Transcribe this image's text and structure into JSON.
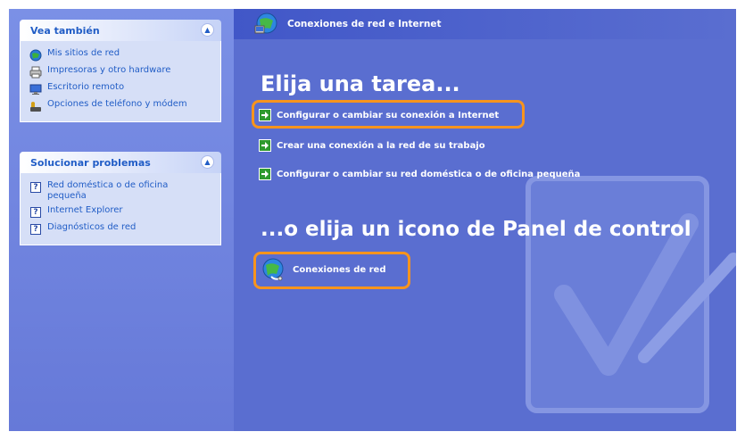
{
  "sidebar": {
    "see_also": {
      "title": "Vea también",
      "items": [
        {
          "label": "Mis sitios de red",
          "icon": "network-places-icon"
        },
        {
          "label": "Impresoras y otro hardware",
          "icon": "printer-icon"
        },
        {
          "label": "Escritorio remoto",
          "icon": "remote-desktop-icon"
        },
        {
          "label": "Opciones de teléfono y módem",
          "icon": "phone-modem-icon"
        }
      ]
    },
    "troubleshoot": {
      "title": "Solucionar problemas",
      "items": [
        {
          "label": "Red doméstica o de oficina pequeña",
          "icon": "help-icon"
        },
        {
          "label": "Internet Explorer",
          "icon": "help-icon"
        },
        {
          "label": "Diagnósticos de red",
          "icon": "help-icon"
        }
      ]
    }
  },
  "main": {
    "title": "Conexiones de red e Internet",
    "pick_task_heading": "Elija una tarea...",
    "tasks": [
      {
        "label": "Configurar o cambiar su conexión a Internet",
        "icon": "green-arrow-icon"
      },
      {
        "label": "Crear una conexión a la red de su trabajo",
        "icon": "green-arrow-icon"
      },
      {
        "label": "Configurar o cambiar su red doméstica o de oficina pequeña",
        "icon": "green-arrow-icon"
      }
    ],
    "pick_icon_heading": "...o elija un icono de Panel de control",
    "control_panel_items": [
      {
        "label": "Conexiones de red",
        "icon": "network-connections-icon"
      }
    ]
  },
  "colors": {
    "main_background": "#5a6ed0",
    "sidebar_background": "#7b90e6",
    "panel_title": "#215dc6",
    "highlight": "#f7941d",
    "task_arrow": "#2f9a2f"
  }
}
